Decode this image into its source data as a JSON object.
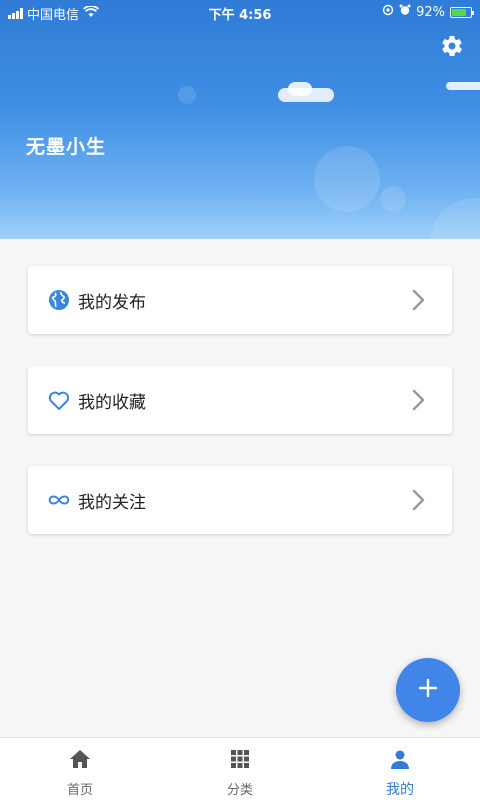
{
  "status_bar": {
    "carrier": "中国电信",
    "time": "下午 4:56",
    "battery": "92%"
  },
  "profile": {
    "username": "无墨小生"
  },
  "menu": [
    {
      "label": "我的发布",
      "icon": "globe-icon"
    },
    {
      "label": "我的收藏",
      "icon": "heart-icon"
    },
    {
      "label": "我的关注",
      "icon": "infinity-icon"
    }
  ],
  "bottom_nav": [
    {
      "label": "首页",
      "icon": "home-icon",
      "active": false
    },
    {
      "label": "分类",
      "icon": "grid-icon",
      "active": false
    },
    {
      "label": "我的",
      "icon": "person-icon",
      "active": true
    }
  ],
  "colors": {
    "accent": "#2f7bd6",
    "fab": "#4285e8",
    "icon_blue": "#3a86e0",
    "nav_inactive": "#555555"
  }
}
